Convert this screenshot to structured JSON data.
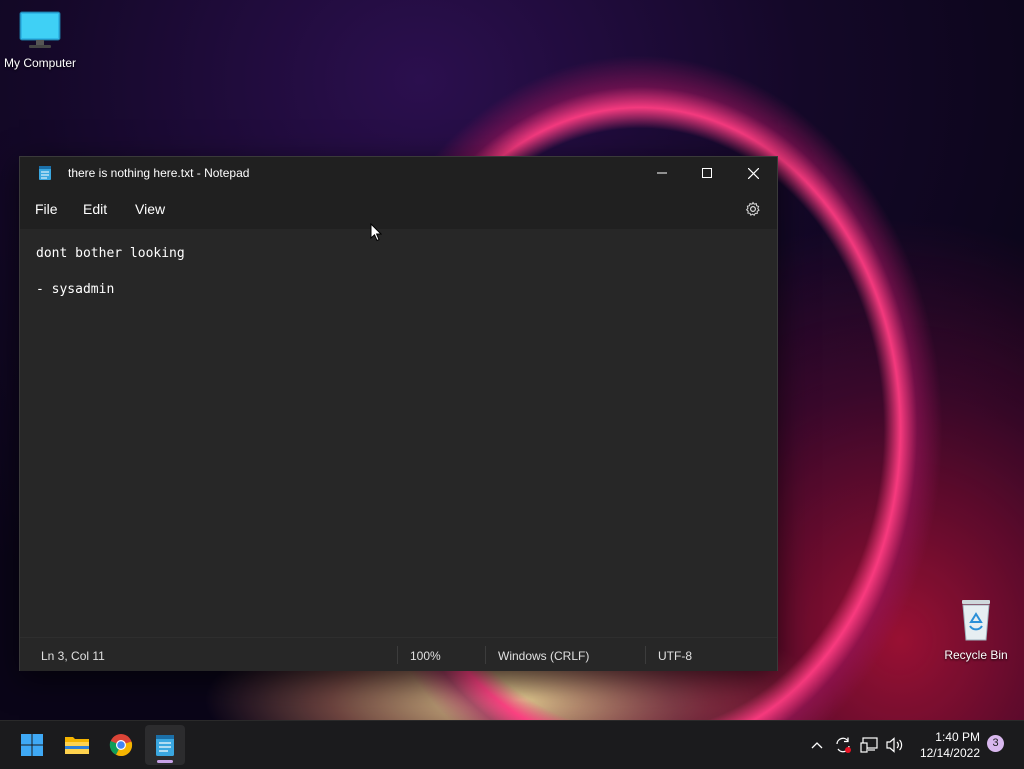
{
  "desktop": {
    "icons": [
      {
        "label": "My Computer",
        "icon": "monitor-icon"
      },
      {
        "label": "Recycle Bin",
        "icon": "recycle-bin-icon"
      }
    ]
  },
  "window": {
    "title": "there is nothing here.txt - Notepad",
    "app_icon": "notepad-icon",
    "menu": [
      "File",
      "Edit",
      "View"
    ],
    "settings_icon": "gear-icon",
    "content_lines": [
      "dont bother looking",
      "",
      "- sysadmin"
    ],
    "status": {
      "position": "Ln 3, Col 11",
      "zoom": "100%",
      "line_ending": "Windows (CRLF)",
      "encoding": "UTF-8"
    }
  },
  "taskbar": {
    "apps": [
      "windows-start-icon",
      "file-explorer-icon",
      "chrome-icon",
      "notepad-icon"
    ],
    "active_app": "notepad-icon",
    "tray_icons": [
      "chevron-up-icon",
      "sync-icon",
      "network-icon",
      "volume-icon"
    ],
    "time": "1:40 PM",
    "date": "12/14/2022",
    "notification_count": "3"
  },
  "colors": {
    "window_bg": "#272727",
    "titlebar_bg": "#202020",
    "taskbar_bg": "#1b1b1d",
    "notification_badge": "#d9b8ee"
  }
}
